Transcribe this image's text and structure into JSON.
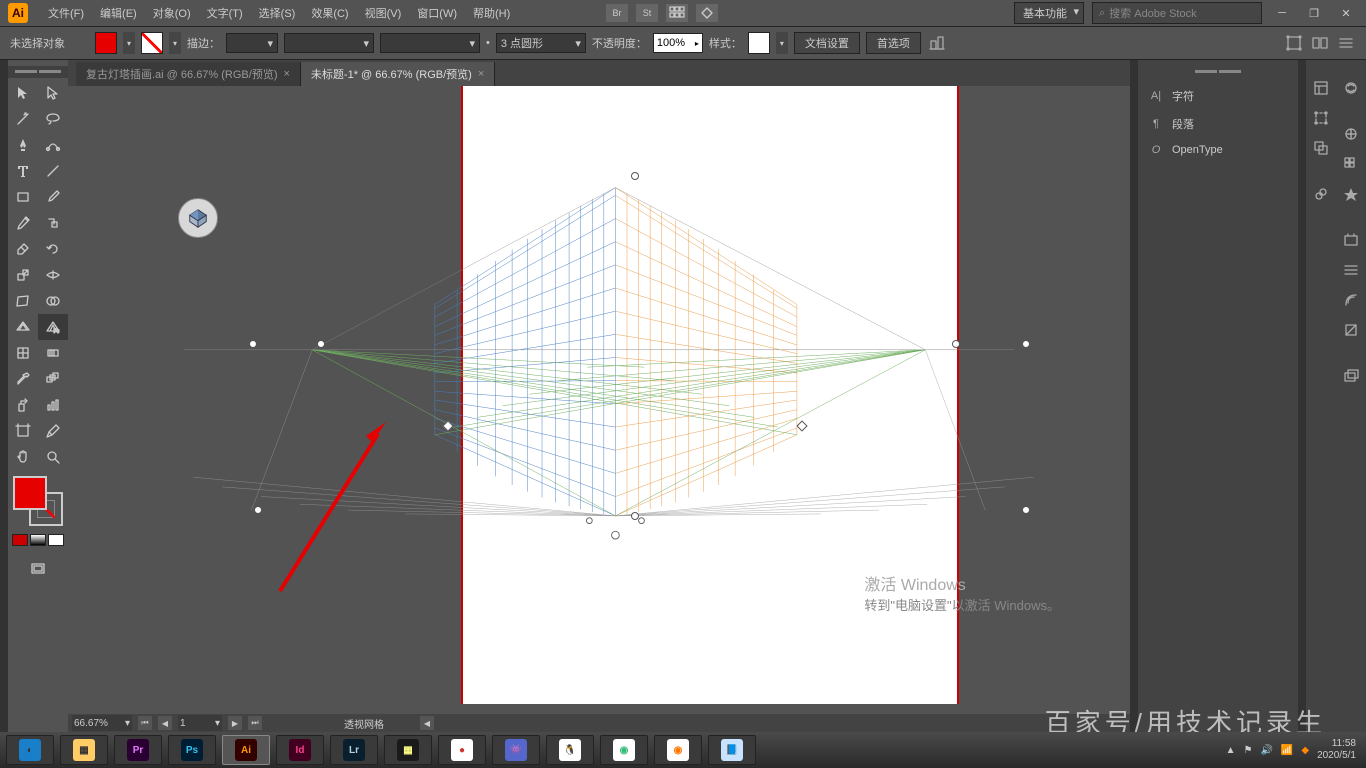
{
  "app": {
    "logo": "Ai"
  },
  "menu": [
    "文件(F)",
    "编辑(E)",
    "对象(O)",
    "文字(T)",
    "选择(S)",
    "效果(C)",
    "视图(V)",
    "窗口(W)",
    "帮助(H)"
  ],
  "menubar_right": {
    "br": "Br",
    "st": "St",
    "workspace": "基本功能",
    "search_placeholder": "搜索 Adobe Stock"
  },
  "control": {
    "selection": "未选择对象",
    "stroke_label": "描边：",
    "stroke_weight": "",
    "vp_preset": "3 点圆形",
    "opacity_label": "不透明度：",
    "opacity": "100%",
    "style_label": "样式：",
    "btn_docsetup": "文档设置",
    "btn_prefs": "首选项"
  },
  "tabs": [
    {
      "label": "复古灯塔插画.ai @ 66.67% (RGB/预览)",
      "active": false
    },
    {
      "label": "未标题-1* @ 66.67% (RGB/预览)",
      "active": true
    }
  ],
  "status": {
    "zoom": "66.67%",
    "page": "1",
    "tool": "透视网格"
  },
  "right_panels": [
    "字符",
    "段落",
    "OpenType"
  ],
  "watermark": {
    "title": "激活 Windows",
    "sub": "转到\"电脑设置\"以激活 Windows。"
  },
  "big_watermark": "百家号/用技术记录生",
  "taskbar": {
    "apps": [
      {
        "name": "browser",
        "bg": "#1a7fc9",
        "txt": "◐"
      },
      {
        "name": "explorer",
        "bg": "#ffcc66",
        "txt": "▦"
      },
      {
        "name": "premiere",
        "bg": "#2a0033",
        "txt": "Pr",
        "color": "#e479ff"
      },
      {
        "name": "photoshop",
        "bg": "#001d33",
        "txt": "Ps",
        "color": "#31c5f4"
      },
      {
        "name": "illustrator",
        "bg": "#330000",
        "txt": "Ai",
        "color": "#ff9a00",
        "active": true
      },
      {
        "name": "indesign",
        "bg": "#41001f",
        "txt": "Id",
        "color": "#ff3e8f"
      },
      {
        "name": "lightroom",
        "bg": "#0a1f2d",
        "txt": "Lr",
        "color": "#aed4e6"
      },
      {
        "name": "app1",
        "bg": "#1a1a1a",
        "txt": "▦",
        "color": "#ff8"
      },
      {
        "name": "ball",
        "bg": "#fff",
        "txt": "●",
        "color": "#c33"
      },
      {
        "name": "reddit",
        "bg": "#56c",
        "txt": "👾",
        "color": "#fff"
      },
      {
        "name": "qq",
        "bg": "#fff",
        "txt": "🐧"
      },
      {
        "name": "chrome",
        "bg": "#fff",
        "txt": "◉",
        "color": "#3b7"
      },
      {
        "name": "firefox",
        "bg": "#fff",
        "txt": "◉",
        "color": "#f70"
      },
      {
        "name": "notes",
        "bg": "#c9e3ff",
        "txt": "📘"
      }
    ],
    "time": "11:58",
    "date": "2020/5/1"
  }
}
